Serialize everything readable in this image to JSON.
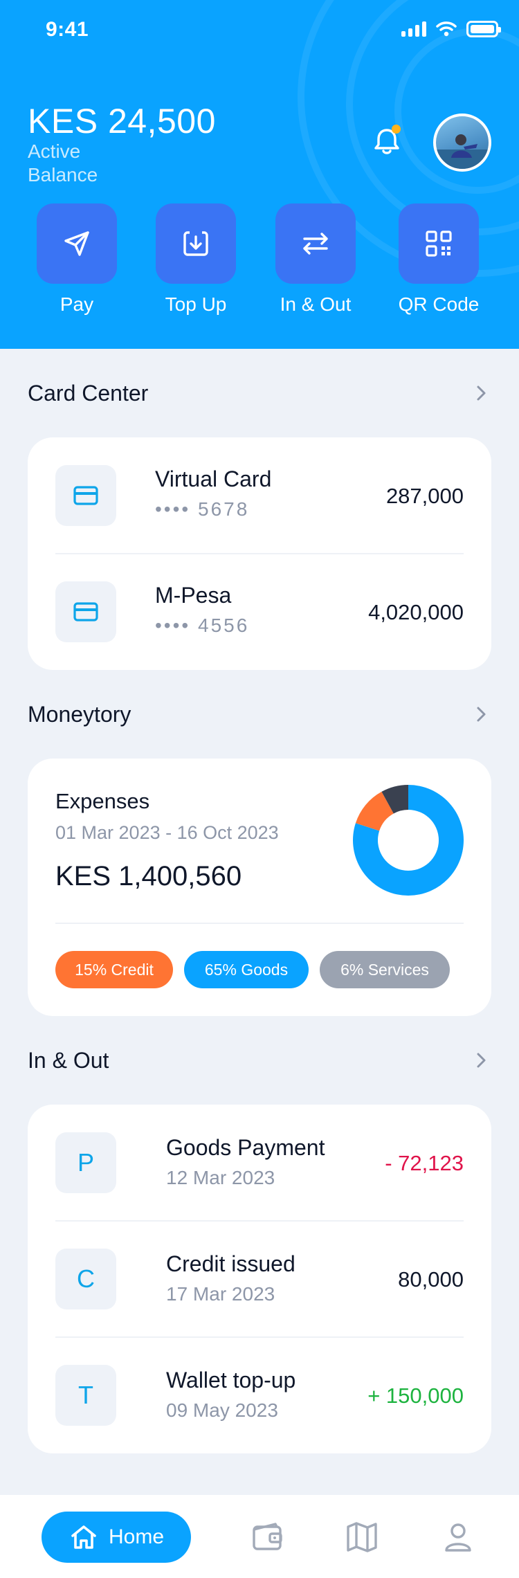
{
  "status_bar": {
    "time": "9:41"
  },
  "header": {
    "balance": "KES 24,500",
    "balance_label": "Active Balance"
  },
  "actions": [
    {
      "label": "Pay",
      "icon": "send-icon"
    },
    {
      "label": "Top Up",
      "icon": "download-icon"
    },
    {
      "label": "In & Out",
      "icon": "transfer-arrows-icon"
    },
    {
      "label": "QR Code",
      "icon": "qr-code-icon"
    }
  ],
  "card_center": {
    "title": "Card Center",
    "cards": [
      {
        "name": "Virtual Card",
        "number": "•••• 5678",
        "amount": "287,000",
        "icon": "credit-card-icon"
      },
      {
        "name": "M-Pesa",
        "number": "•••• 4556",
        "amount": "4,020,000",
        "icon": "credit-card-icon"
      }
    ]
  },
  "moneytory": {
    "title": "Moneytory",
    "label": "Expenses",
    "period": "01 Mar 2023 - 16 Oct 2023",
    "total": "KES 1,400,560",
    "tags": [
      {
        "label": "15% Credit",
        "color": "#ff7433"
      },
      {
        "label": "65% Goods",
        "color": "#0aa3ff"
      },
      {
        "label": "6% Services",
        "color": "#9ba3b1"
      }
    ],
    "chart_data": {
      "type": "pie",
      "donut": true,
      "slices": [
        {
          "label": "Goods",
          "color": "#0aa3ff"
        },
        {
          "label": "Credit",
          "color": "#ff7433"
        },
        {
          "label": "Services",
          "color": "#3a4150"
        }
      ],
      "values": [
        80,
        12,
        8
      ]
    }
  },
  "in_out": {
    "title": "In & Out",
    "transactions": [
      {
        "initial": "P",
        "name": "Goods Payment",
        "date": "12 Mar 2023",
        "amount": "- 72,123",
        "amount_color": "#e0134a"
      },
      {
        "initial": "C",
        "name": "Credit issued",
        "date": "17 Mar 2023",
        "amount": "80,000",
        "amount_color": "#0f172a"
      },
      {
        "initial": "T",
        "name": "Wallet top-up",
        "date": "09 May 2023",
        "amount": "+ 150,000",
        "amount_color": "#1db33f"
      }
    ]
  },
  "bottom_nav": {
    "home_label": "Home",
    "items": [
      {
        "icon": "home-icon"
      },
      {
        "icon": "wallet-icon"
      },
      {
        "icon": "map-icon"
      },
      {
        "icon": "profile-icon"
      }
    ]
  },
  "colors": {
    "brand": "#0aa3ff",
    "action_tile": "#3a74f4",
    "background": "#eef2f8"
  }
}
